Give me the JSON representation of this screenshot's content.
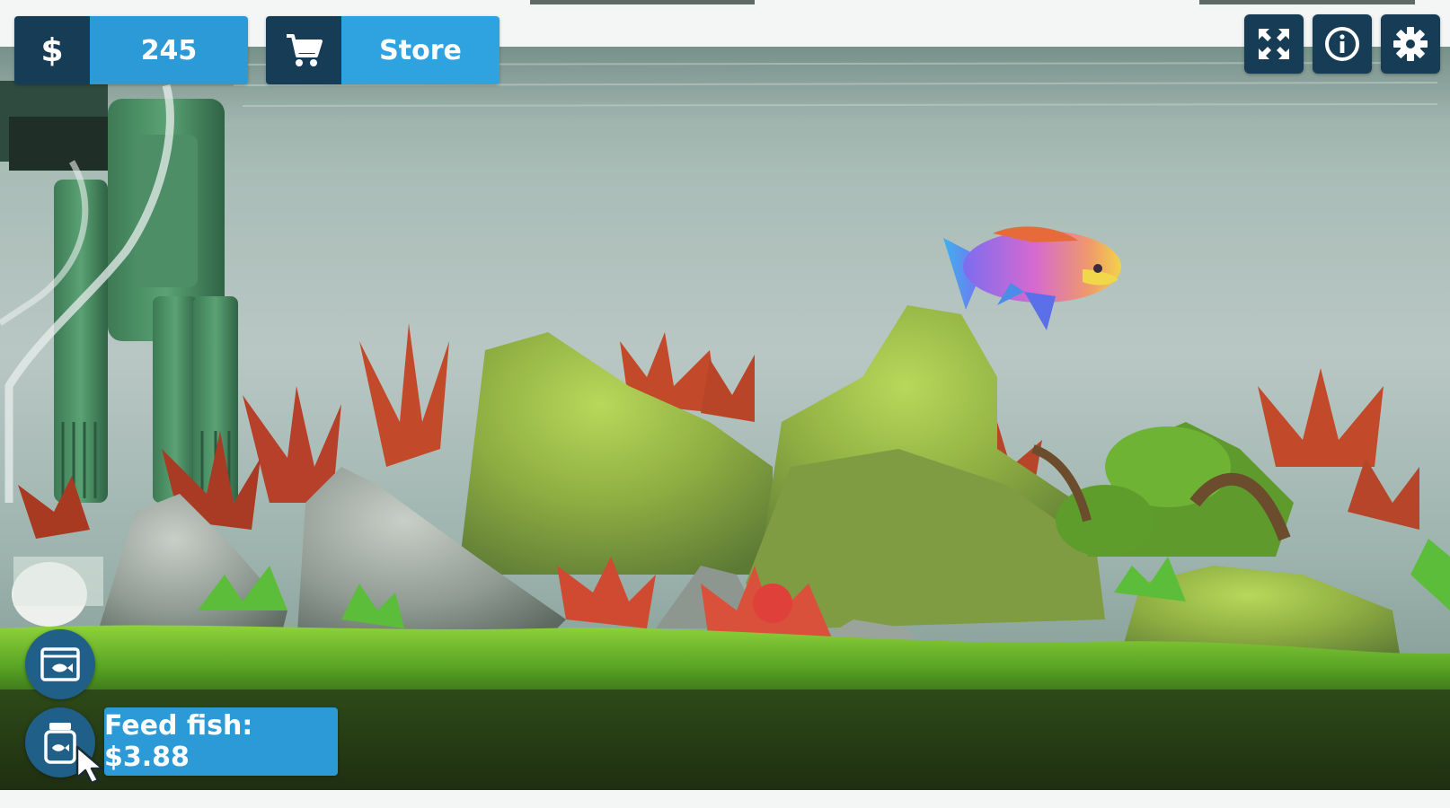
{
  "hud": {
    "money_symbol": "$",
    "money_value": "245",
    "store_label": "Store",
    "feed_tooltip": "Feed fish: $3.88"
  },
  "icons": {
    "money": "dollar-icon",
    "store": "shopping-cart-icon",
    "fullscreen": "fullscreen-icon",
    "info": "info-icon",
    "settings": "gear-icon",
    "tank": "aquarium-icon",
    "feed": "fish-food-jar-icon",
    "cursor": "mouse-pointer-icon"
  },
  "colors": {
    "hud_dark": "#173c56",
    "hud_accent": "#2c9ad6",
    "round_button": "#1f5f88",
    "water": "#9fb6b1",
    "moss": "#7fbf2a",
    "red_plant": "#c84a2e"
  }
}
